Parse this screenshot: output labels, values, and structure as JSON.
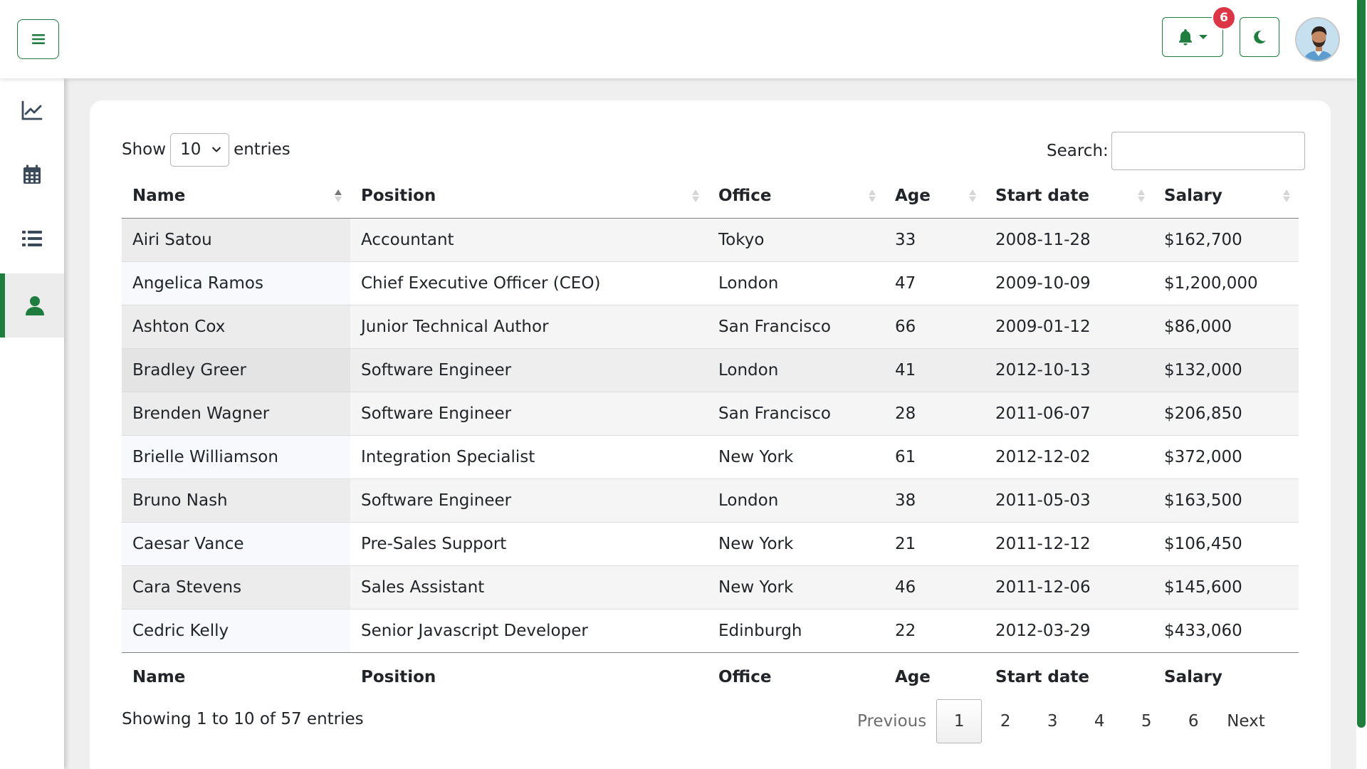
{
  "header": {
    "menu_icon": "hamburger-icon",
    "bell_icon": "bell-icon",
    "notification_count": "6",
    "theme_icon": "moon-icon",
    "accent_color": "#1e7d3f"
  },
  "sidebar": {
    "items": [
      {
        "icon": "chart-line-icon",
        "active": false
      },
      {
        "icon": "calendar-icon",
        "active": false
      },
      {
        "icon": "list-icon",
        "active": false
      },
      {
        "icon": "user-icon",
        "active": true
      }
    ]
  },
  "table_controls": {
    "show_label": "Show",
    "page_length": "10",
    "entries_label": "entries",
    "search_label": "Search:",
    "search_value": ""
  },
  "table": {
    "columns": [
      "Name",
      "Position",
      "Office",
      "Age",
      "Start date",
      "Salary"
    ],
    "rows": [
      [
        "Airi Satou",
        "Accountant",
        "Tokyo",
        "33",
        "2008-11-28",
        "$162,700"
      ],
      [
        "Angelica Ramos",
        "Chief Executive Officer (CEO)",
        "London",
        "47",
        "2009-10-09",
        "$1,200,000"
      ],
      [
        "Ashton Cox",
        "Junior Technical Author",
        "San Francisco",
        "66",
        "2009-01-12",
        "$86,000"
      ],
      [
        "Bradley Greer",
        "Software Engineer",
        "London",
        "41",
        "2012-10-13",
        "$132,000"
      ],
      [
        "Brenden Wagner",
        "Software Engineer",
        "San Francisco",
        "28",
        "2011-06-07",
        "$206,850"
      ],
      [
        "Brielle Williamson",
        "Integration Specialist",
        "New York",
        "61",
        "2012-12-02",
        "$372,000"
      ],
      [
        "Bruno Nash",
        "Software Engineer",
        "London",
        "38",
        "2011-05-03",
        "$163,500"
      ],
      [
        "Caesar Vance",
        "Pre-Sales Support",
        "New York",
        "21",
        "2011-12-12",
        "$106,450"
      ],
      [
        "Cara Stevens",
        "Sales Assistant",
        "New York",
        "46",
        "2011-12-06",
        "$145,600"
      ],
      [
        "Cedric Kelly",
        "Senior Javascript Developer",
        "Edinburgh",
        "22",
        "2012-03-29",
        "$433,060"
      ]
    ]
  },
  "footer": {
    "info": "Showing 1 to 10 of 57 entries",
    "previous": "Previous",
    "pages": [
      "1",
      "2",
      "3",
      "4",
      "5",
      "6"
    ],
    "current_page": "1",
    "next": "Next"
  }
}
